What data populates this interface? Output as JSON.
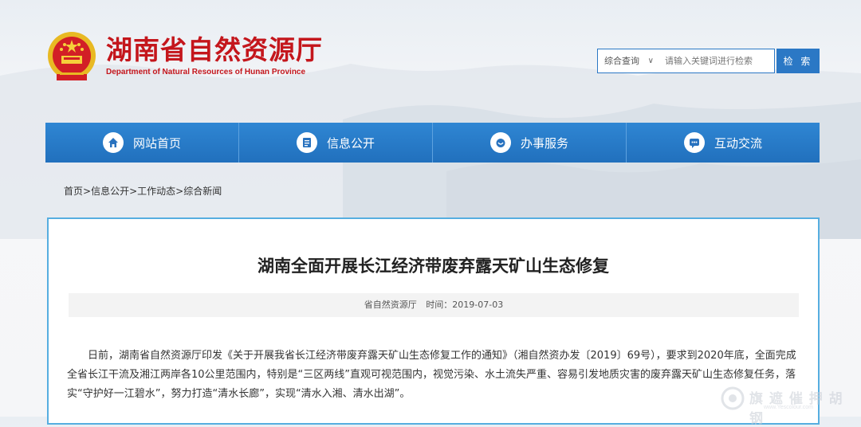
{
  "header": {
    "title": "湖南省自然资源厅",
    "subtitle": "Department of Natural Resources of Hunan Province"
  },
  "search": {
    "scope": "综合查询",
    "placeholder": "请输入关键词进行检索",
    "button": "检 索"
  },
  "nav": {
    "items": [
      {
        "label": "网站首页",
        "icon": "home-icon"
      },
      {
        "label": "信息公开",
        "icon": "document-icon"
      },
      {
        "label": "办事服务",
        "icon": "service-icon"
      },
      {
        "label": "互动交流",
        "icon": "chat-icon"
      }
    ]
  },
  "breadcrumb": {
    "items": [
      "首页",
      "信息公开",
      "工作动态",
      "综合新闻"
    ],
    "separator": ">"
  },
  "article": {
    "title": "湖南全面开展长江经济带废弃露天矿山生态修复",
    "source": "省自然资源厅",
    "time_label": "时间：",
    "time": "2019-07-03",
    "body": "日前，湖南省自然资源厅印发《关于开展我省长江经济带废弃露天矿山生态修复工作的通知》（湘自然资办发〔2019〕69号），要求到2020年底，全面完成全省长江干流及湘江两岸各10公里范围内，特别是“三区两线”直观可视范围内，视觉污染、水土流失严重、容易引发地质灾害的废弃露天矿山生态修复任务，落实“守护好一江碧水”，努力打造“清水长廊”，实现“清水入湘、清水出湖”。"
  },
  "watermark": {
    "text": "旗 遮 催 押 胡 钢",
    "url": "www.Yescolour.com"
  },
  "colors": {
    "brand_red": "#c4161c",
    "nav_blue": "#2b78c5",
    "border_cyan": "#56aee0"
  }
}
